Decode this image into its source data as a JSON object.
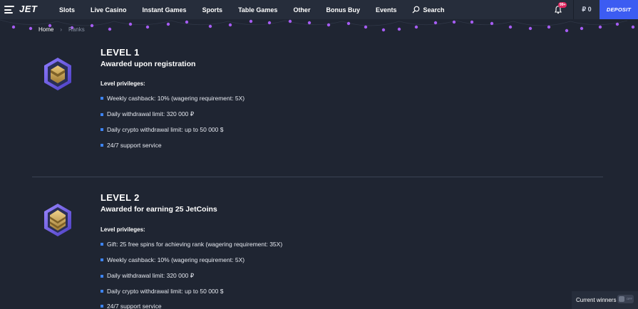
{
  "header": {
    "logo": "JET",
    "nav": [
      "Slots",
      "Live Casino",
      "Instant Games",
      "Sports",
      "Table Games",
      "Other",
      "Bonus Buy",
      "Events"
    ],
    "search_label": "Search",
    "notification_badge": "99+",
    "balance": "₽ 0",
    "deposit_label": "DEPOSIT"
  },
  "breadcrumb": {
    "home": "Home",
    "current": "Ranks"
  },
  "levels": [
    {
      "title": "LEVEL 1",
      "subtitle": "Awarded upon registration",
      "privileges_label": "Level privileges:",
      "items": [
        "Weekly cashback: 10% (wagering requirement: 5X)",
        "Daily withdrawal limit: 320 000 ₽",
        "Daily crypto withdrawal limit: up to 50 000 $",
        "24/7 support service"
      ]
    },
    {
      "title": "LEVEL 2",
      "subtitle": "Awarded for earning 25 JetCoins",
      "privileges_label": "Level privileges:",
      "items": [
        "Gift: 25 free spins for achieving rank (wagering requirement: 35X)",
        "Weekly cashback: 10% (wagering requirement: 5X)",
        "Daily withdrawal limit: 320 000 ₽",
        "Daily crypto withdrawal limit: up to 50 000 $",
        "24/7 support service"
      ]
    }
  ],
  "winners": {
    "label": "Current winners",
    "toggle": "OFF"
  },
  "colors": {
    "background": "#1f2532",
    "header": "#262d3b",
    "accent": "#3c5cf2",
    "bullet": "#3d84f5",
    "garland_light": "#a55cf2",
    "badge_gold": "#c9a14a",
    "badge_frame": "#7a6cf0"
  }
}
